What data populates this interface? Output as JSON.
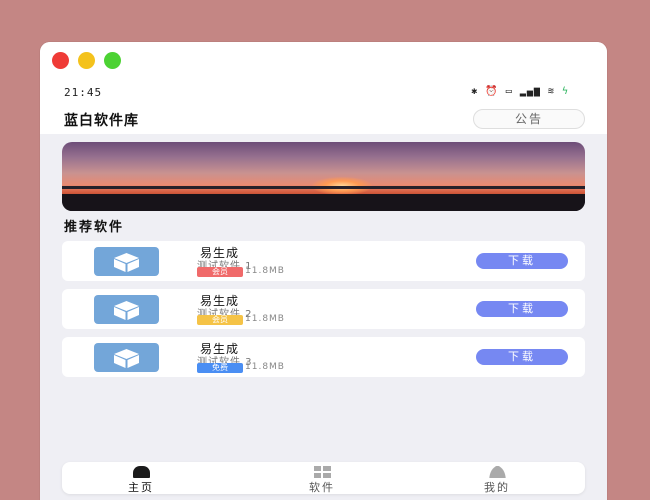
{
  "status_bar": {
    "time": "21:45",
    "icons": [
      "bluetooth-icon",
      "alarm-icon",
      "battery-icon",
      "signal-icon",
      "wifi-icon",
      "charging-icon"
    ]
  },
  "header": {
    "title": "蓝白软件库",
    "notice_label": "公告"
  },
  "section": {
    "title": "推荐软件"
  },
  "apps": [
    {
      "name": "易生成",
      "subtitle": "测试软件 1",
      "badge": "会员",
      "badge_color": "#f06a6a",
      "size": "11.8MB",
      "action": "下载"
    },
    {
      "name": "易生成",
      "subtitle": "测试软件 2",
      "badge": "会员",
      "badge_color": "#f5c347",
      "size": "11.8MB",
      "action": "下载"
    },
    {
      "name": "易生成",
      "subtitle": "测试软件 3",
      "badge": "免费",
      "badge_color": "#4a8ef3",
      "size": "11.8MB",
      "action": "下载"
    }
  ],
  "tabs": [
    {
      "label": "主页",
      "icon": "home-icon",
      "active": true
    },
    {
      "label": "软件",
      "icon": "grid-icon",
      "active": false
    },
    {
      "label": "我的",
      "icon": "user-icon",
      "active": false
    }
  ],
  "colors": {
    "background": "#c48684",
    "accent": "#7688f2",
    "app_icon": "#73a6d9"
  }
}
